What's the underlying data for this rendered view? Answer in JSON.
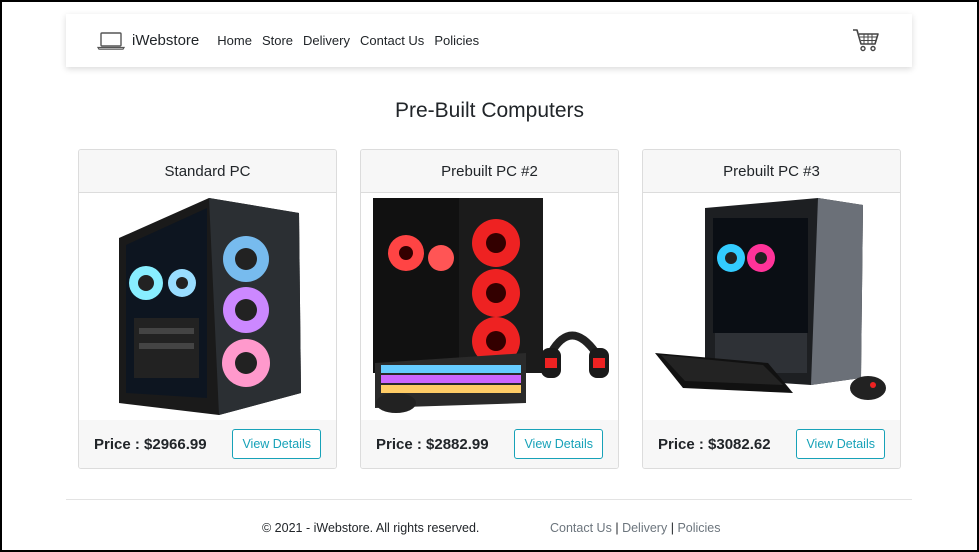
{
  "navbar": {
    "brand": "iWebstore",
    "links": [
      "Home",
      "Store",
      "Delivery",
      "Contact Us",
      "Policies"
    ],
    "brand_icon": "laptop-icon",
    "cart_icon": "shopping-cart-icon"
  },
  "page": {
    "title": "Pre-Built Computers"
  },
  "products": [
    {
      "name": "Standard PC",
      "price": "Price : $2966.99",
      "button": "View Details"
    },
    {
      "name": "Prebuilt PC #2",
      "price": "Price : $2882.99",
      "button": "View Details"
    },
    {
      "name": "Prebuilt PC #3",
      "price": "Price : $3082.62",
      "button": "View Details"
    }
  ],
  "footer": {
    "copyright": "© 2021 - iWebstore. All rights reserved.",
    "links": [
      "Contact Us",
      "Delivery",
      "Policies"
    ],
    "separator": "|"
  },
  "colors": {
    "accent": "#17a2b8",
    "muted_link": "#6c757d",
    "card_header_bg": "#f7f7f7"
  }
}
